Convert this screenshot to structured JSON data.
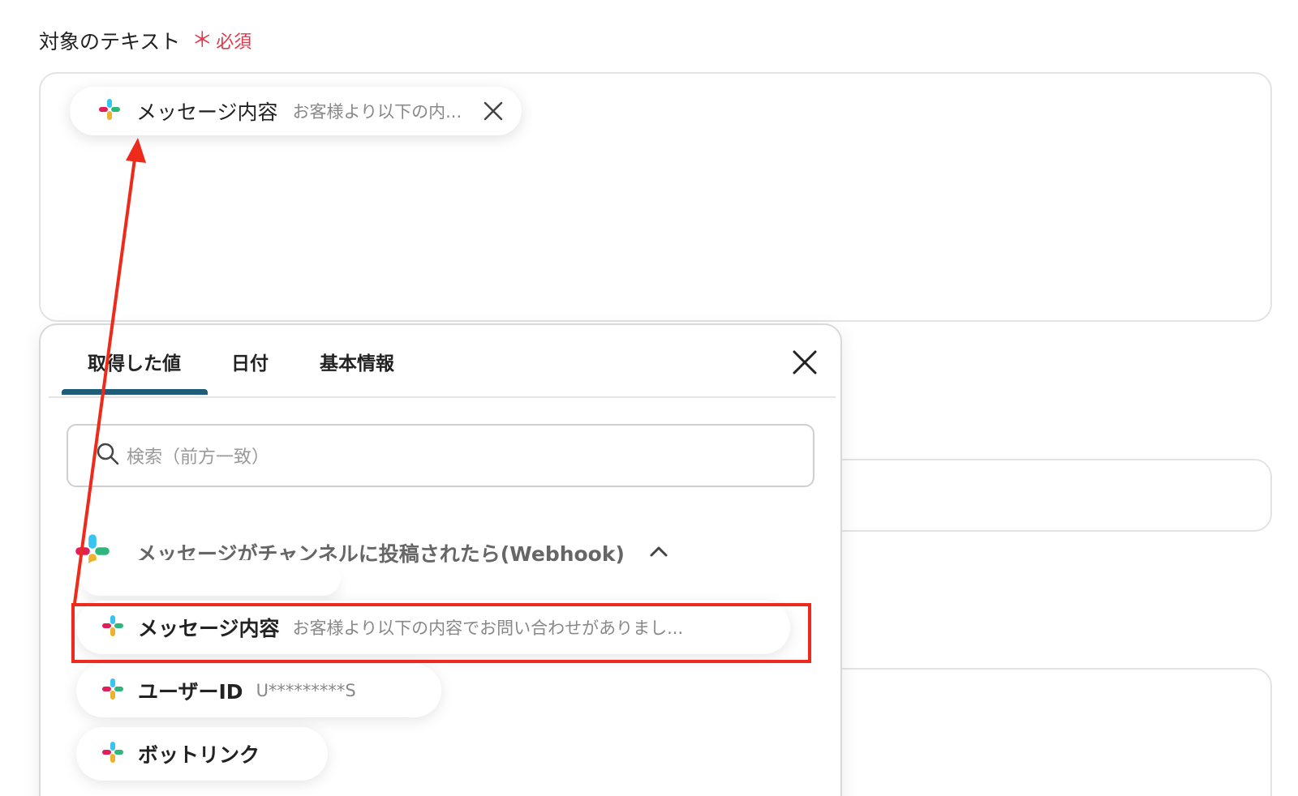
{
  "field": {
    "label": "対象のテキスト",
    "required_mark": "＊",
    "required_text": "必須"
  },
  "selected_chip": {
    "icon": "slack-icon",
    "label": "メッセージ内容",
    "preview": "お客様より以下の内...",
    "remove_icon": "close-icon"
  },
  "picker": {
    "tabs": [
      {
        "label": "取得した値",
        "active": true
      },
      {
        "label": "日付",
        "active": false
      },
      {
        "label": "基本情報",
        "active": false
      }
    ],
    "close_icon": "close-icon",
    "search": {
      "icon": "search-icon",
      "placeholder": "検索（前方一致）"
    },
    "section": {
      "icon": "slack-icon",
      "title": "メッセージがチャンネルに投稿されたら(Webhook)",
      "toggle_icon": "chevron-up-icon"
    },
    "items": [
      {
        "icon": "slack-icon",
        "label": "メッセージ内容",
        "preview": "お客様より以下の内容でお問い合わせがありまし..."
      },
      {
        "icon": "slack-icon",
        "label": "ユーザーID",
        "preview": "U*********S"
      },
      {
        "icon": "slack-icon",
        "label": "ボットリンク",
        "preview": ""
      }
    ]
  },
  "annotation": {
    "color": "#ee2a1b"
  },
  "colors": {
    "required": "#e2384a",
    "tab_underline": "#1e5c78",
    "slack_blue": "#36c5f0",
    "slack_green": "#2eb67d",
    "slack_yellow": "#ecb22e",
    "slack_red": "#e01e5a"
  }
}
